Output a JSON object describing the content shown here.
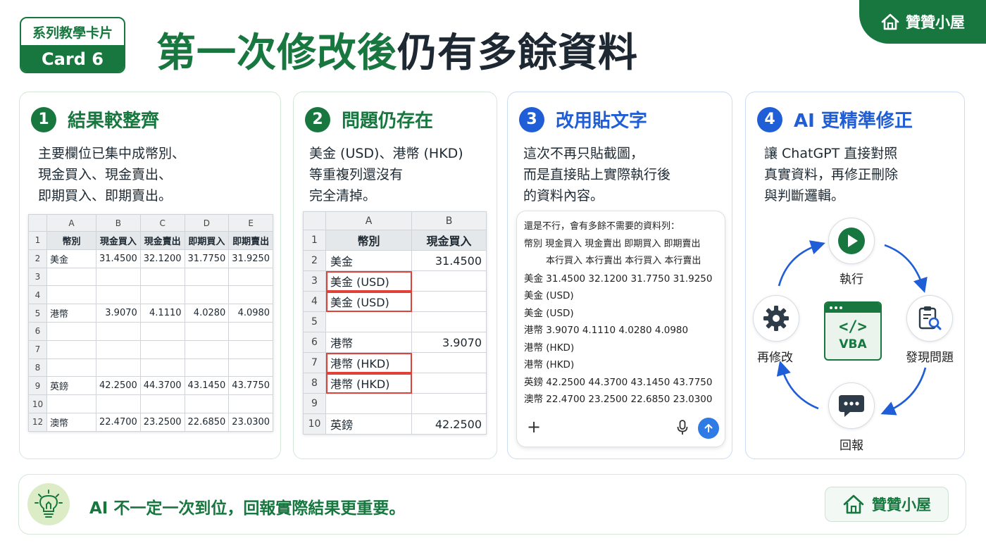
{
  "header": {
    "series_label": "系列教學卡片",
    "card_label": "Card 6",
    "title_green": "第一次修改後",
    "title_dark": "仍有多餘資料",
    "brand": "贊贊小屋"
  },
  "colors": {
    "primary_green": "#17773f",
    "primary_blue": "#1f5ed6",
    "highlight_red": "#e0423a"
  },
  "cards": [
    {
      "number": "1",
      "title": "結果較整齊",
      "lines": [
        "主要欄位已集中成幣別、",
        "現金買入、現金賣出、",
        "即期買入、即期賣出。"
      ]
    },
    {
      "number": "2",
      "title": "問題仍存在",
      "lines": [
        "美金 (USD)、港幣 (HKD)",
        "等重複列還沒有",
        "完全清掉。"
      ]
    },
    {
      "number": "3",
      "title": "改用貼文字",
      "lines": [
        "這次不再只貼截圖，",
        "而是直接貼上實際執行後",
        "的資料內容。"
      ]
    },
    {
      "number": "4",
      "title": "AI 更精準修正",
      "lines": [
        "讓 ChatGPT 直接對照",
        "真實資料，再修正刪除",
        "與判斷邏輯。"
      ]
    }
  ],
  "sheet1": {
    "columns": [
      "A",
      "B",
      "C",
      "D",
      "E"
    ],
    "rows": [
      [
        "1",
        "幣別",
        "現金買入",
        "現金賣出",
        "即期買入",
        "即期賣出"
      ],
      [
        "2",
        "美金",
        "31.4500",
        "32.1200",
        "31.7750",
        "31.9250"
      ],
      [
        "3",
        "",
        "",
        "",
        "",
        ""
      ],
      [
        "4",
        "",
        "",
        "",
        "",
        ""
      ],
      [
        "5",
        "港幣",
        "3.9070",
        "4.1110",
        "4.0280",
        "4.0980"
      ],
      [
        "6",
        "",
        "",
        "",
        "",
        ""
      ],
      [
        "7",
        "",
        "",
        "",
        "",
        ""
      ],
      [
        "8",
        "",
        "",
        "",
        "",
        ""
      ],
      [
        "9",
        "英鎊",
        "42.2500",
        "44.3700",
        "43.1450",
        "43.7750"
      ],
      [
        "10",
        "",
        "",
        "",
        "",
        ""
      ],
      [
        "12",
        "澳幣",
        "22.4700",
        "23.2500",
        "22.6850",
        "23.0300"
      ]
    ]
  },
  "sheet2": {
    "columns": [
      "A",
      "B"
    ],
    "rows": [
      [
        "1",
        "幣別",
        "現金買入"
      ],
      [
        "2",
        "美金",
        "31.4500"
      ],
      [
        "3",
        "美金 (USD)",
        ""
      ],
      [
        "4",
        "美金 (USD)",
        ""
      ],
      [
        "5",
        "",
        ""
      ],
      [
        "6",
        "港幣",
        "3.9070"
      ],
      [
        "7",
        "港幣 (HKD)",
        ""
      ],
      [
        "8",
        "港幣 (HKD)",
        ""
      ],
      [
        "9",
        "",
        ""
      ],
      [
        "10",
        "英鎊",
        "42.2500"
      ]
    ]
  },
  "chat": {
    "lines": [
      "還是不行，會有多餘不需要的資料列：",
      "幣別 現金買入 現金賣出 即期買入 即期賣出",
      "本行買入 本行賣出 本行買入 本行賣出",
      "美金 31.4500  32.1200  31.7750  31.9250",
      "美金 (USD)",
      "美金 (USD)",
      "港幣 3.9070  4.1110  4.0280  4.0980",
      "港幣 (HKD)",
      "港幣 (HKD)",
      "英鎊 42.2500  44.3700  43.1450  43.7750",
      "澳幣 22.4700  23.2500  22.6850  23.0300"
    ],
    "plus": "+"
  },
  "cycle": {
    "run": "執行",
    "find": "發現問題",
    "report": "回報",
    "revise": "再修改",
    "center_code": "</>",
    "center_label": "VBA",
    "icons": [
      "play-icon",
      "clipboard-search-icon",
      "chat-bubble-icon",
      "gear-icon"
    ]
  },
  "footer": {
    "message": "AI 不一定一次到位，回報實際結果更重要。",
    "brand": "贊贊小屋"
  }
}
